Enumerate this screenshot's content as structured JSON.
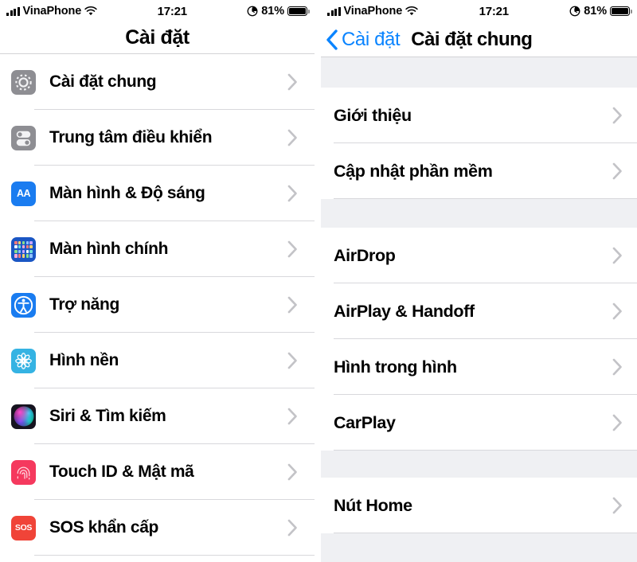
{
  "status_bar": {
    "carrier": "VinaPhone",
    "time": "17:21",
    "battery_percent": "81%",
    "wifi_icon": "wifi-icon",
    "signal_icon": "signal-bars-icon",
    "alarm_icon": "alarm-clock-icon",
    "battery_icon": "battery-icon"
  },
  "left_screen": {
    "title": "Cài đặt",
    "items": [
      {
        "label": "Cài đặt chung",
        "icon": "gear-icon",
        "icon_class": "ic-gear"
      },
      {
        "label": "Trung tâm điều khiển",
        "icon": "control-center-icon",
        "icon_class": "ic-control"
      },
      {
        "label": "Màn hình & Độ sáng",
        "icon": "display-icon",
        "icon_class": "ic-display",
        "icon_text": "AA"
      },
      {
        "label": "Màn hình chính",
        "icon": "home-screen-icon",
        "icon_class": "ic-home"
      },
      {
        "label": "Trợ năng",
        "icon": "accessibility-icon",
        "icon_class": "ic-access"
      },
      {
        "label": "Hình nền",
        "icon": "wallpaper-icon",
        "icon_class": "ic-wall"
      },
      {
        "label": "Siri & Tìm kiếm",
        "icon": "siri-icon",
        "icon_class": "ic-siri"
      },
      {
        "label": "Touch ID & Mật mã",
        "icon": "touch-id-icon",
        "icon_class": "ic-touch"
      },
      {
        "label": "SOS khẩn cấp",
        "icon": "sos-icon",
        "icon_class": "ic-sos",
        "icon_text": "SOS"
      }
    ]
  },
  "right_screen": {
    "back_label": "Cài đặt",
    "back_icon": "chevron-left-icon",
    "title": "Cài đặt chung",
    "sections": [
      {
        "items": [
          {
            "label": "Giới thiệu"
          },
          {
            "label": "Cập nhật phần mềm"
          }
        ]
      },
      {
        "items": [
          {
            "label": "AirDrop"
          },
          {
            "label": "AirPlay & Handoff"
          },
          {
            "label": "Hình trong hình"
          },
          {
            "label": "CarPlay"
          }
        ]
      },
      {
        "items": [
          {
            "label": "Nút Home"
          }
        ]
      }
    ]
  },
  "colors": {
    "accent": "#0a84ff",
    "group_bg": "#eff0f3",
    "separator": "#d8d8dc",
    "chevron": "#c3c3c7"
  }
}
